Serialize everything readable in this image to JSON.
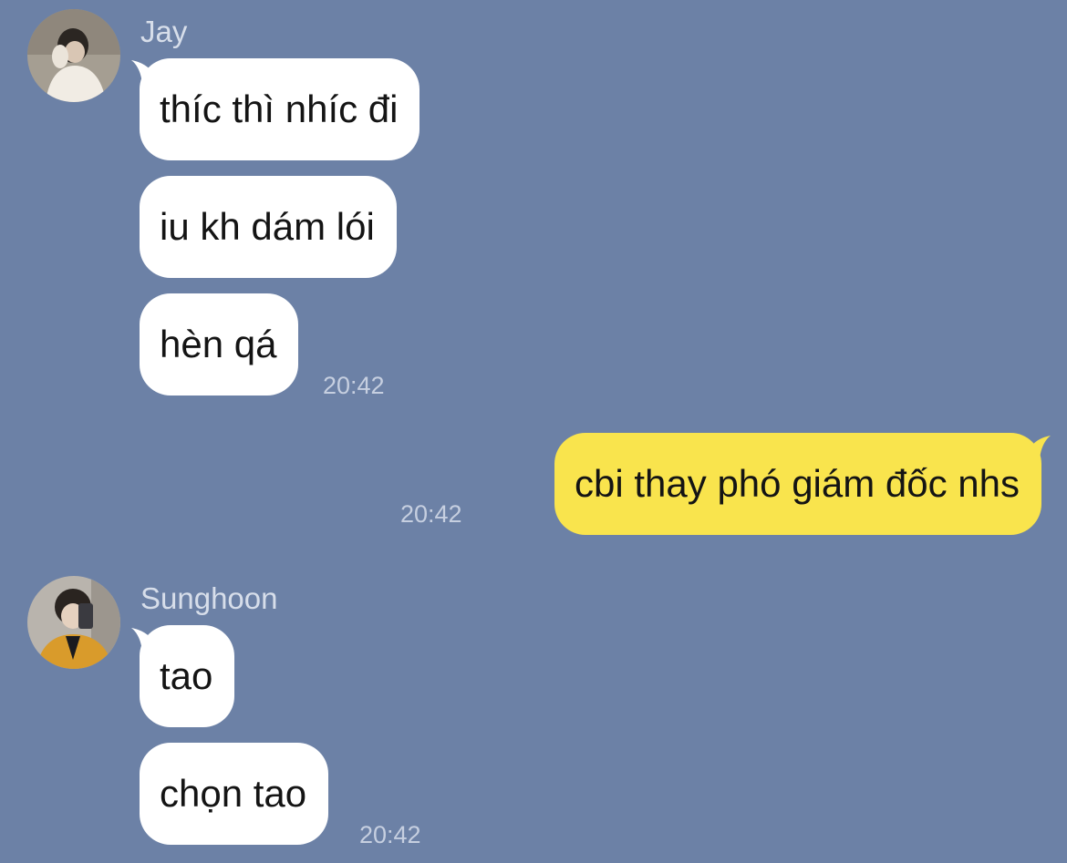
{
  "colors": {
    "background": "#6c81a6",
    "incoming_bubble": "#ffffff",
    "outgoing_bubble": "#f9e44d",
    "name_text": "#d7deea",
    "time_text": "#c6cfe0"
  },
  "messages": [
    {
      "sender": "Jay",
      "avatar": "profile-photo-jay",
      "bubbles": [
        "thíc thì nhíc đi",
        "iu kh dám lói",
        "hèn qá"
      ],
      "time": "20:42"
    },
    {
      "sender": "me",
      "bubbles": [
        "cbi thay phó giám đốc nhs"
      ],
      "time": "20:42"
    },
    {
      "sender": "Sunghoon",
      "avatar": "profile-photo-sunghoon",
      "bubbles": [
        "tao",
        "chọn tao"
      ],
      "time": "20:42"
    }
  ]
}
